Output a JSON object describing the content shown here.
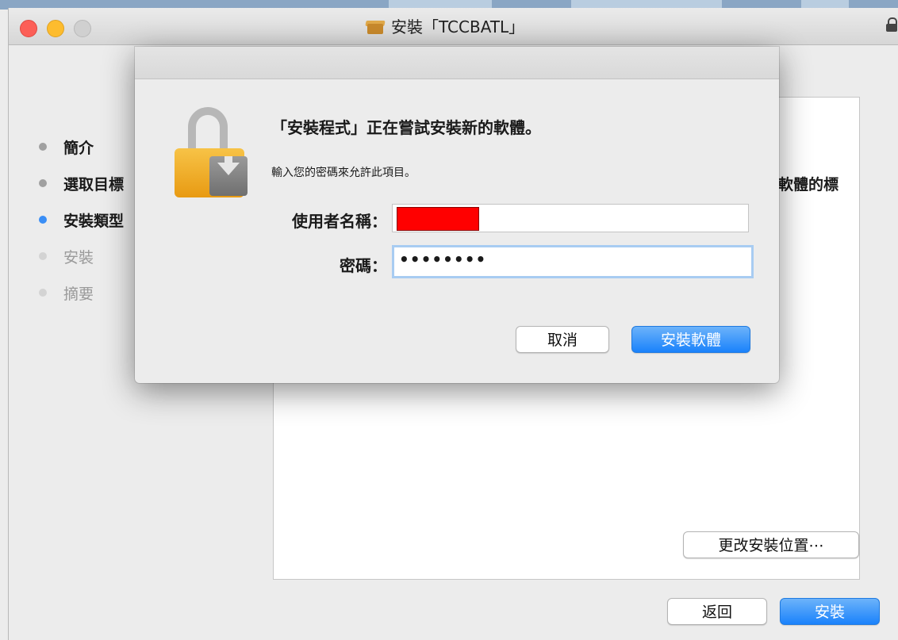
{
  "window": {
    "title": "安裝「TCCBATL」",
    "icon": "package-icon"
  },
  "sidebar": {
    "items": [
      {
        "label": "簡介",
        "state": "done"
      },
      {
        "label": "選取目標",
        "state": "done"
      },
      {
        "label": "安裝類型",
        "state": "active"
      },
      {
        "label": "安裝",
        "state": "pending"
      },
      {
        "label": "摘要",
        "state": "pending"
      }
    ]
  },
  "content": {
    "partial_text": "軟體的標",
    "change_location_label": "更改安裝位置⋯"
  },
  "footer": {
    "back_label": "返回",
    "install_label": "安裝"
  },
  "auth_dialog": {
    "heading": "「安裝程式」正在嘗試安裝新的軟體。",
    "subtext": "輸入您的密碼來允許此項目。",
    "username_label": "使用者名稱：",
    "username_value": "",
    "password_label": "密碼：",
    "password_value": "••••••••",
    "cancel_label": "取消",
    "confirm_label": "安裝軟體"
  },
  "colors": {
    "accent": "#3a8ef6",
    "close": "#fc5f57",
    "minimize": "#fdbc2e",
    "redaction": "#ff0000"
  }
}
